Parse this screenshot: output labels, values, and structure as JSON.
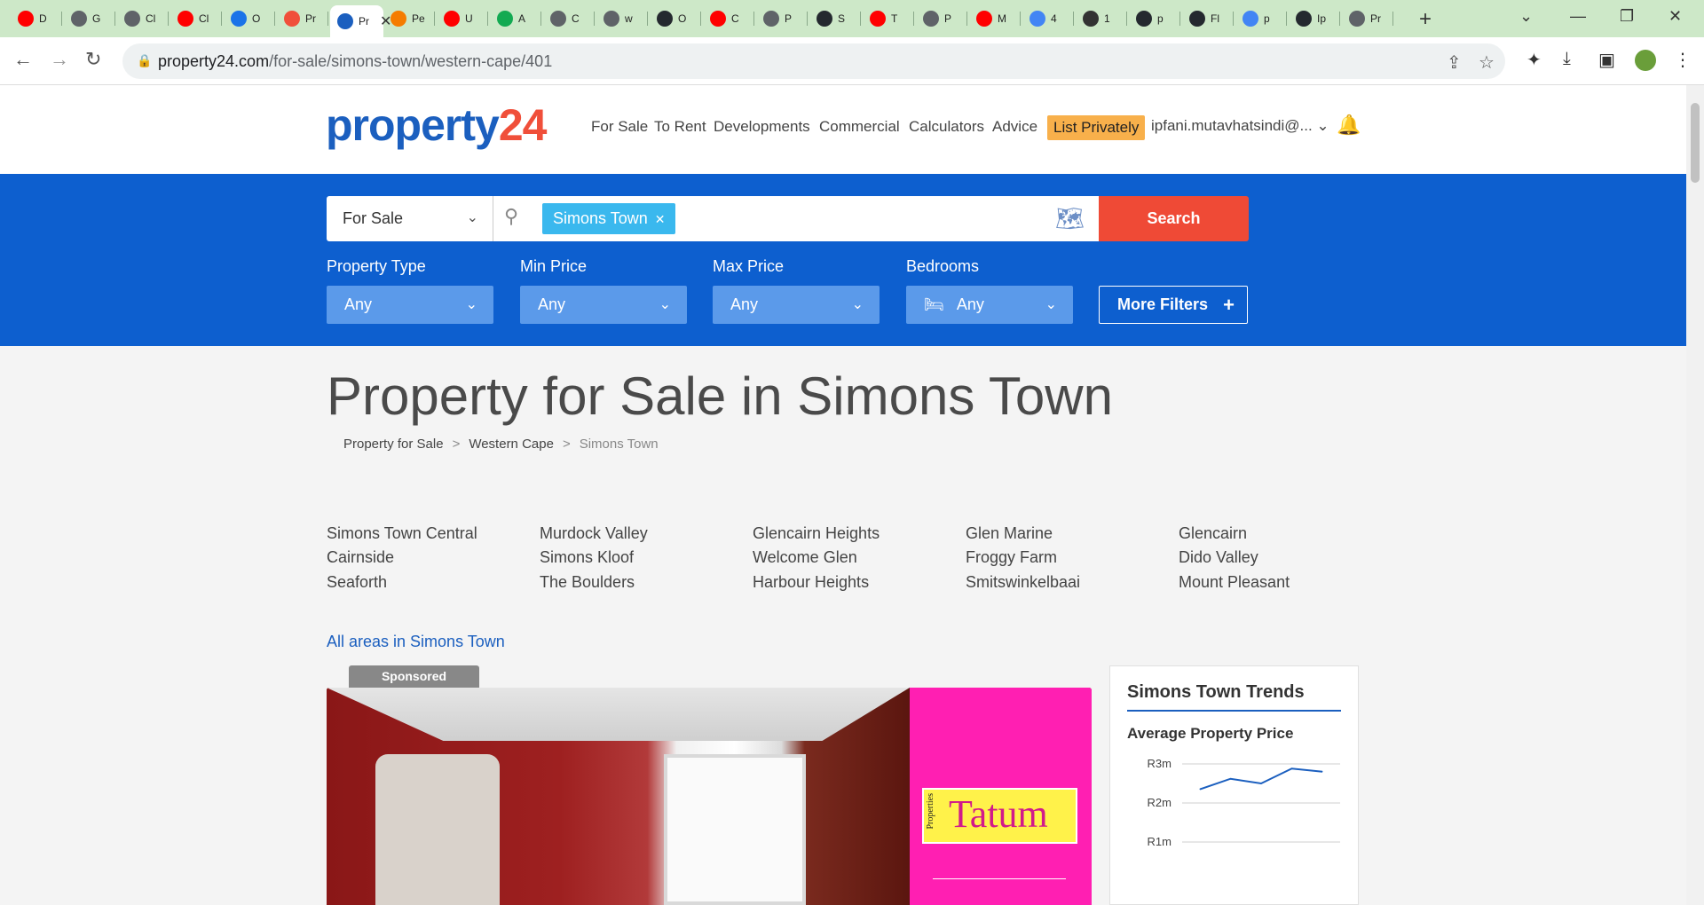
{
  "browser": {
    "tabs": [
      {
        "label": "D",
        "color": "#ff0000"
      },
      {
        "label": "G",
        "color": "#5f6368"
      },
      {
        "label": "Cl",
        "color": "#5f6368"
      },
      {
        "label": "Cl",
        "color": "#ff0000"
      },
      {
        "label": "O",
        "color": "#1a73e8"
      },
      {
        "label": "Pr",
        "color": "#f04f3a"
      },
      {
        "label": "Pr",
        "color": "#1b5fbf"
      },
      {
        "label": "Pe",
        "color": "#f57c00"
      },
      {
        "label": "U",
        "color": "#ff0000"
      },
      {
        "label": "A",
        "color": "#13aa52"
      },
      {
        "label": "C",
        "color": "#5f6368"
      },
      {
        "label": "w",
        "color": "#5f6368"
      },
      {
        "label": "O",
        "color": "#24292f"
      },
      {
        "label": "C",
        "color": "#ff0000"
      },
      {
        "label": "P",
        "color": "#5f6368"
      },
      {
        "label": "S",
        "color": "#24292f"
      },
      {
        "label": "T",
        "color": "#ff0000"
      },
      {
        "label": "P",
        "color": "#5f6368"
      },
      {
        "label": "M",
        "color": "#ff0000"
      },
      {
        "label": "4",
        "color": "#4285f4"
      },
      {
        "label": "1",
        "color": "#333333"
      },
      {
        "label": "p",
        "color": "#24292f"
      },
      {
        "label": "Fl",
        "color": "#24292f"
      },
      {
        "label": "p",
        "color": "#4285f4"
      },
      {
        "label": "Ip",
        "color": "#24292f"
      },
      {
        "label": "Pr",
        "color": "#5f6368"
      }
    ],
    "url_host": "property24.com",
    "url_path": "/for-sale/simons-town/western-cape/401"
  },
  "header": {
    "logo_part1": "property",
    "logo_part2": "24",
    "nav": [
      "For Sale",
      "To Rent",
      "Developments",
      "Commercial",
      "Calculators",
      "Advice"
    ],
    "list_privately": "List Privately",
    "user": "ipfani.mutavhatsindi@..."
  },
  "search": {
    "listing_type": "For Sale",
    "chip": "Simons Town",
    "button": "Search",
    "filters": [
      {
        "label": "Property Type",
        "value": "Any"
      },
      {
        "label": "Min Price",
        "value": "Any"
      },
      {
        "label": "Max Price",
        "value": "Any"
      },
      {
        "label": "Bedrooms",
        "value": "Any"
      }
    ],
    "more_filters": "More Filters"
  },
  "page_title": "Property for Sale in Simons Town",
  "breadcrumb": [
    "Property for Sale",
    "Western Cape",
    "Simons Town"
  ],
  "areas": [
    [
      "Simons Town Central",
      "Cairnside",
      "Seaforth"
    ],
    [
      "Murdock Valley",
      "Simons Kloof",
      "The Boulders"
    ],
    [
      "Glencairn Heights",
      "Welcome Glen",
      "Harbour Heights"
    ],
    [
      "Glen Marine",
      "Froggy Farm",
      "Smitswinkelbaai"
    ],
    [
      "Glencairn",
      "Dido Valley",
      "Mount Pleasant"
    ]
  ],
  "all_areas": "All areas in Simons Town",
  "listing": {
    "badge": "Sponsored",
    "agency_name": "Tatum",
    "agency_side": "Properties"
  },
  "trends": {
    "title": "Simons Town Trends",
    "subtitle": "Average Property Price",
    "chart_data": {
      "type": "line",
      "y_ticks": [
        "R3m",
        "R2m",
        "R1m"
      ],
      "ylim": [
        1,
        3
      ],
      "values": [
        2.35,
        2.62,
        2.5,
        2.88,
        2.8
      ]
    }
  }
}
